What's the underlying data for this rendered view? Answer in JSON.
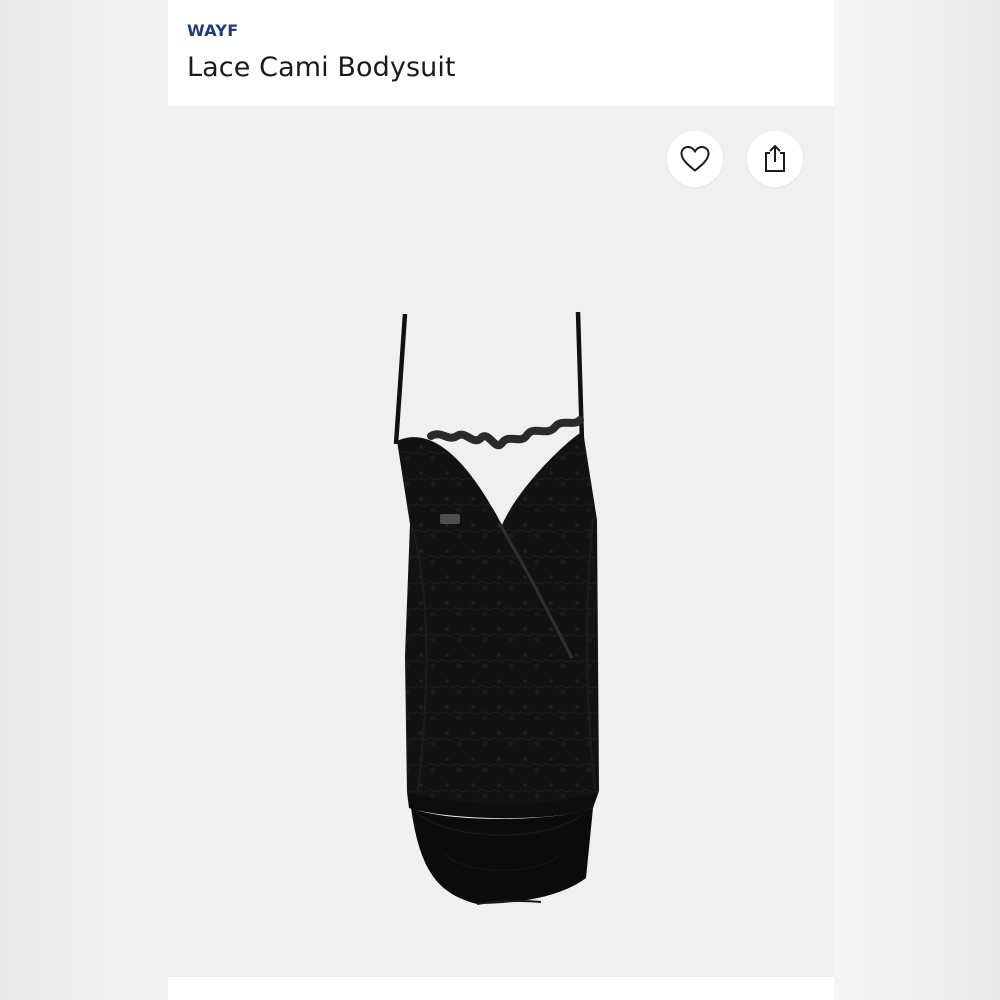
{
  "product": {
    "brand": "WAYF",
    "title": "Lace Cami Bodysuit"
  },
  "actions": {
    "favorite_icon": "heart-icon",
    "share_icon": "share-icon"
  },
  "colors": {
    "brand_blue": "#1f3b7a",
    "photo_background": "#f0f0f1",
    "garment": "#111111"
  }
}
